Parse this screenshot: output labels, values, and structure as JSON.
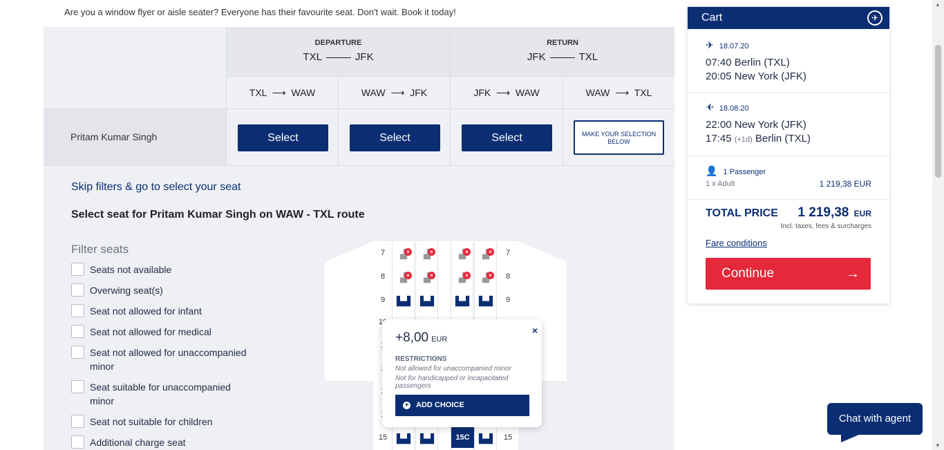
{
  "intro_text": "Are you a window flyer or aisle seater? Everyone has their favourite seat. Don't wait. Book it today!",
  "departure": {
    "label": "DEPARTURE",
    "from": "TXL",
    "to": "JFK"
  },
  "return": {
    "label": "RETURN",
    "from": "JFK",
    "to": "TXL"
  },
  "segments": [
    {
      "from": "TXL",
      "to": "WAW"
    },
    {
      "from": "WAW",
      "to": "JFK"
    },
    {
      "from": "JFK",
      "to": "WAW"
    },
    {
      "from": "WAW",
      "to": "TXL"
    }
  ],
  "passenger_name": "Pritam Kumar Singh",
  "select_label": "Select",
  "make_selection_label": "MAKE YOUR SELECTION BELOW",
  "skip_filters": "Skip filters & go to select your seat",
  "select_seat_title": "Select seat for Pritam Kumar Singh on WAW - TXL route",
  "filter_title": "Filter seats",
  "filters": [
    "Seats not available",
    "Overwing seat(s)",
    "Seat not allowed for infant",
    "Seat not allowed for medical",
    "Seat not allowed for unaccompanied minor",
    "Seat suitable for unaccompanied minor",
    "Seat not suitable for children",
    "Additional charge seat"
  ],
  "seatmap": {
    "rows": [
      "7",
      "8",
      "9",
      "10",
      "1",
      "1",
      "1",
      "1",
      "15"
    ],
    "selected_seat": "15C"
  },
  "popup": {
    "price": "+8,00",
    "currency": "EUR",
    "restrictions_title": "RESTRICTIONS",
    "restriction1": "Not allowed for unaccompanied minor",
    "restriction2": "Not for handicapped or incapacitated passengers",
    "add_choice": "ADD CHOICE",
    "close": "×"
  },
  "cart": {
    "title": "Cart",
    "outbound": {
      "date": "18.07.20",
      "dep": "07:40 Berlin (TXL)",
      "arr": "20:05 New York (JFK)"
    },
    "inbound": {
      "date": "18.08.20",
      "dep": "22:00 New York (JFK)",
      "arr_time": "17:45",
      "arr_plus": "(+1d)",
      "arr_city": "Berlin (TXL)"
    },
    "passengers": "1 Passenger",
    "pax_type": "1 x Adult",
    "pax_price": "1 219,38 EUR",
    "total_label": "TOTAL PRICE",
    "total_value": "1 219,38",
    "total_currency": "EUR",
    "incl": "Incl. taxes, fees & surcharges",
    "fare_conditions": "Fare conditions",
    "continue": "Continue"
  },
  "chat_label": "Chat with agent"
}
